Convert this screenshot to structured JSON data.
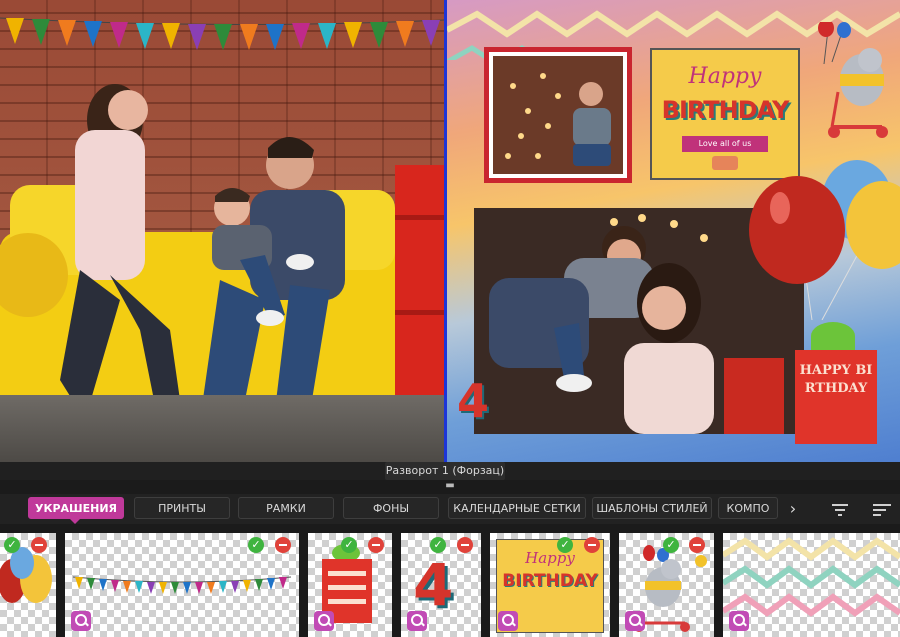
{
  "canvas": {
    "spread_label": "Разворот 1 (Форзац)",
    "birthday_card": {
      "line1": "Happy",
      "line2": "BIRTHDAY",
      "line3": "Love all of us"
    },
    "number_sticker": "4",
    "gift_text": "HAPPY BIRTHDAY"
  },
  "tabs": [
    {
      "label": "УКРАШЕНИЯ",
      "active": true
    },
    {
      "label": "ПРИНТЫ",
      "active": false
    },
    {
      "label": "РАМКИ",
      "active": false
    },
    {
      "label": "ФОНЫ",
      "active": false
    },
    {
      "label": "КАЛЕНДАРНЫЕ СЕТКИ",
      "active": false
    },
    {
      "label": "ШАБЛОНЫ СТИЛЕЙ",
      "active": false
    },
    {
      "label": "КОМПО",
      "active": false
    }
  ],
  "icons": {
    "next": "chevron-right-icon",
    "filter": "filter-icon",
    "sort": "sort-icon",
    "check": "check-icon",
    "remove": "minus-icon",
    "zoom": "zoom-icon"
  },
  "colors": {
    "accent": "#c0399a",
    "divider": "#1c35d8",
    "check": "#3fb43f",
    "remove": "#e0423a"
  },
  "thumbnails": [
    {
      "name": "balloons",
      "used": true
    },
    {
      "name": "bunting",
      "used": true
    },
    {
      "name": "gift-box",
      "used": true
    },
    {
      "name": "number-4",
      "used": true
    },
    {
      "name": "happy-birthday-card",
      "used": true
    },
    {
      "name": "bear-scooter",
      "used": true
    },
    {
      "name": "zigzag-lines",
      "used": false
    }
  ],
  "thumb_texts": {
    "number": "4",
    "card_line1": "Happy",
    "card_line2": "BIRTHDAY"
  }
}
